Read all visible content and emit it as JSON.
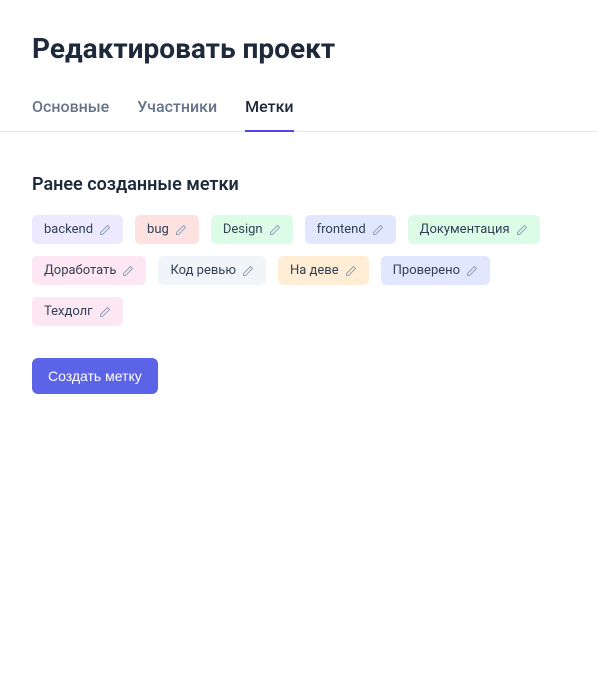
{
  "page_title": "Редактировать проект",
  "tabs": [
    {
      "label": "Основные",
      "active": false
    },
    {
      "label": "Участники",
      "active": false
    },
    {
      "label": "Метки",
      "active": true
    }
  ],
  "section_title": "Ранее созданные метки",
  "tags": [
    {
      "label": "backend",
      "color": "#ede9fe"
    },
    {
      "label": "bug",
      "color": "#fee2e2"
    },
    {
      "label": "Design",
      "color": "#dcfce7"
    },
    {
      "label": "frontend",
      "color": "#e0e7ff"
    },
    {
      "label": "Документация",
      "color": "#dcfce7"
    },
    {
      "label": "Доработать",
      "color": "#fce7f3"
    },
    {
      "label": "Код ревью",
      "color": "#f1f5f9"
    },
    {
      "label": "На деве",
      "color": "#ffedd5"
    },
    {
      "label": "Проверено",
      "color": "#e0e7ff"
    },
    {
      "label": "Техдолг",
      "color": "#fce7f3"
    }
  ],
  "create_button": "Создать метку",
  "colors": {
    "accent": "#5b63e6",
    "text": "#1e293b",
    "muted": "#64748b",
    "border": "#e2e8f0"
  }
}
